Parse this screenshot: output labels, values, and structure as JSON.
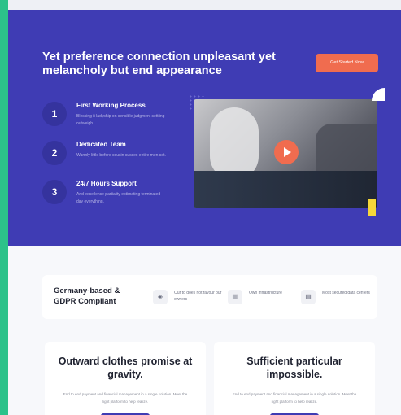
{
  "hero": {
    "title": "Yet preference connection unpleasant yet melancholy but end appearance",
    "cta_label": "Get Started Now",
    "steps": [
      {
        "number": "1",
        "title": "First Working Process",
        "desc": "Blessing it ladyship on sensible judgment settling outweigh."
      },
      {
        "number": "2",
        "title": "Dedicated Team",
        "desc": "Warmly little before cousin sussex entire men set."
      },
      {
        "number": "3",
        "title": "24/7 Hours Support",
        "desc": "And excellence partiality estimating terminated day everything."
      }
    ]
  },
  "trust": {
    "title": "Germany-based & GDPR Compliant",
    "items": [
      {
        "icon": "shield-icon",
        "label": "Our to does not favour our owners"
      },
      {
        "icon": "building-icon",
        "label": "Own infrastructure"
      },
      {
        "icon": "server-icon",
        "label": "Most secured data centers"
      }
    ]
  },
  "cards": [
    {
      "title": "Outward clothes promise at gravity.",
      "desc": "End to end payment and financial management in a single solution. Meet the right platform to help realize."
    },
    {
      "title": "Sufficient particular impossible.",
      "desc": "End to end payment and financial management in a single solution. Meet the right platform to help realize."
    }
  ],
  "colors": {
    "primary": "#3f3cb4",
    "accent": "#f06c4f",
    "strip": "#2cc28a"
  }
}
